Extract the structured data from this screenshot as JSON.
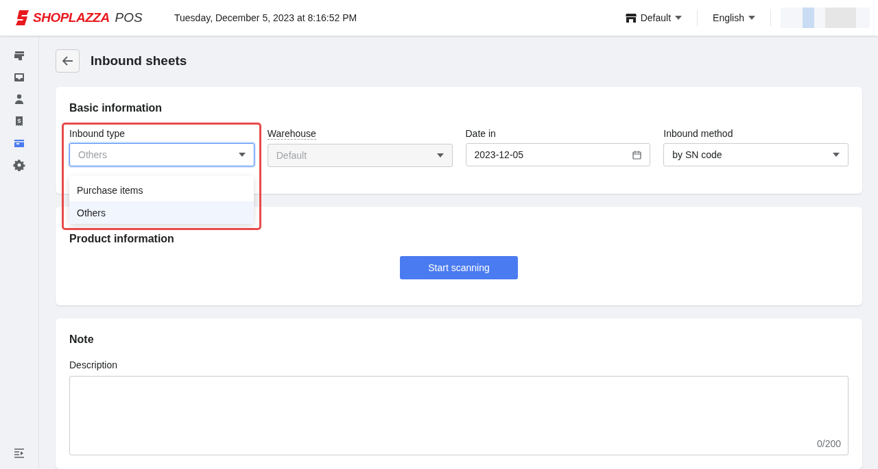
{
  "header": {
    "logo": "SHOPLAZZA",
    "logo_suffix": "POS",
    "datetime": "Tuesday, December 5, 2023 at 8:16:52 PM",
    "store": "Default",
    "language": "English"
  },
  "sidebar": {
    "items": [
      {
        "selected": false
      },
      {
        "selected": false
      },
      {
        "selected": false
      },
      {
        "selected": false
      },
      {
        "selected": true
      },
      {
        "selected": false
      }
    ]
  },
  "page": {
    "title": "Inbound sheets"
  },
  "basic_information": {
    "title": "Basic information",
    "fields": [
      {
        "label": "Inbound type",
        "kind": "select",
        "value": "Others",
        "focused": true,
        "disabled": false,
        "hint": false
      },
      {
        "label": "Warehouse",
        "kind": "select",
        "value": "Default",
        "focused": false,
        "disabled": true,
        "hint": true
      },
      {
        "label": "Date in",
        "kind": "date",
        "value": "2023-12-05",
        "focused": false,
        "disabled": false,
        "hint": false
      },
      {
        "label": "Inbound method",
        "kind": "select",
        "value": "by SN code",
        "focused": false,
        "disabled": false,
        "hint": false
      }
    ]
  },
  "dropdown": {
    "options": [
      {
        "label": "Purchase items",
        "selected": false
      },
      {
        "label": "Others",
        "selected": true
      }
    ]
  },
  "product_information": {
    "title": "Product information",
    "button": "Start scanning"
  },
  "note": {
    "title": "Note",
    "label": "Description",
    "counter": "0/200"
  }
}
